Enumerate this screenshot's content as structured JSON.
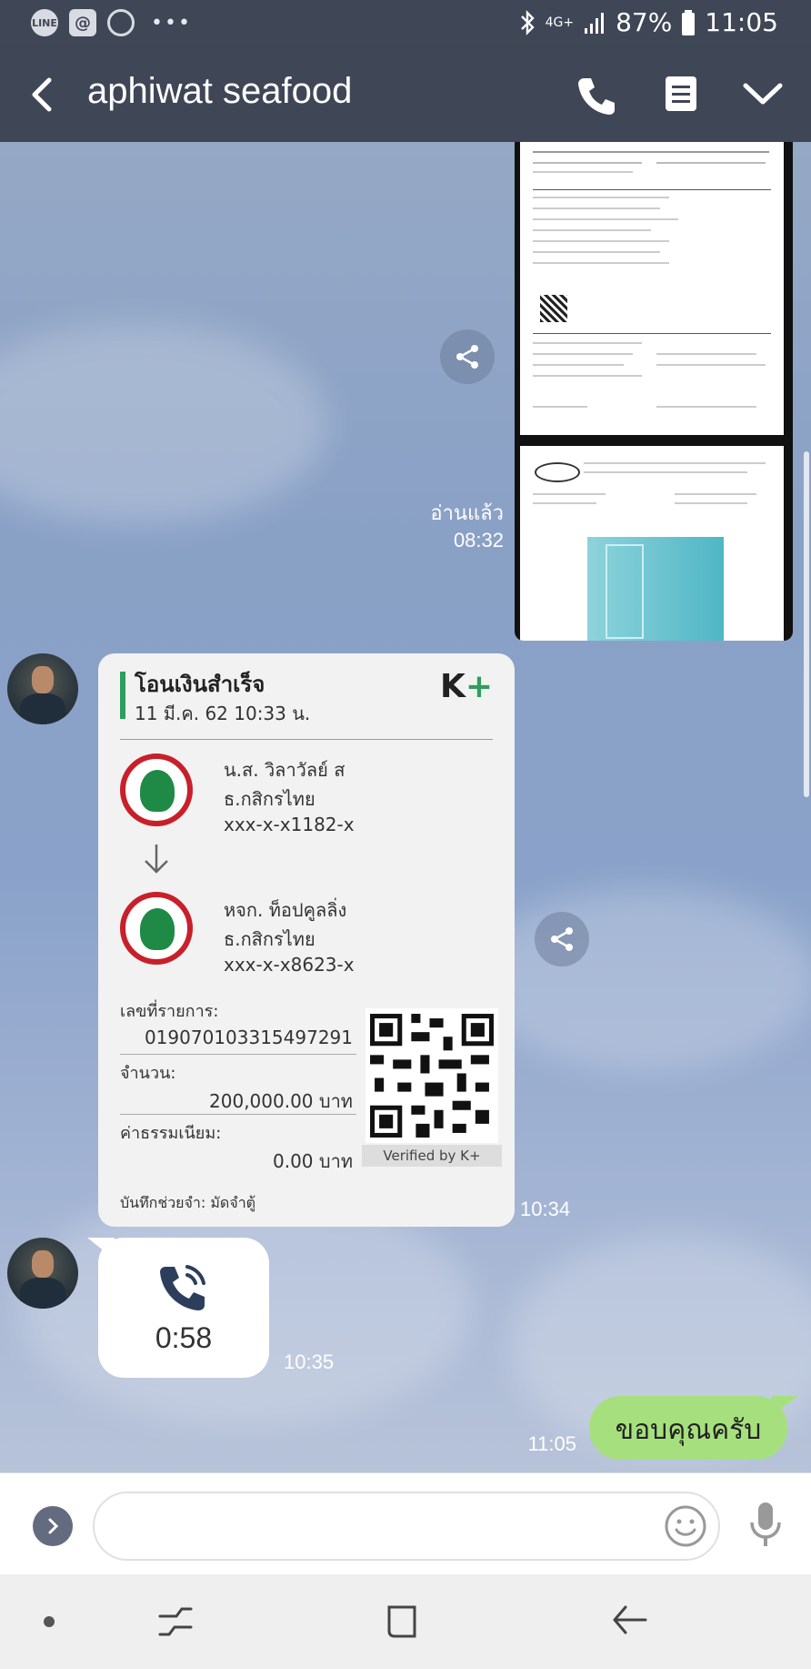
{
  "status_bar": {
    "left_icons": [
      "LINE",
      "@",
      "account-circle"
    ],
    "more": "•••",
    "network": "4G+",
    "battery": "87%",
    "time": "11:05"
  },
  "header": {
    "title": "aphiwat seafood",
    "icons": [
      "back-icon",
      "phone-icon",
      "note-icon",
      "chevron-down-icon"
    ]
  },
  "messages": {
    "image_message": {
      "status": "อ่านแล้ว",
      "time": "08:32"
    },
    "transfer_slip": {
      "title": "โอนเงินสำเร็จ",
      "date": "11 มี.ค. 62  10:33 น.",
      "brand": "K",
      "brand_plus": "+",
      "from_name": "น.ส. วิลาวัลย์ ส",
      "from_bank": "ธ.กสิกรไทย",
      "from_account": "xxx-x-x1182-x",
      "to_name": "หจก. ท็อปคูลลิ่ง",
      "to_bank": "ธ.กสิกรไทย",
      "to_account": "xxx-x-x8623-x",
      "ref_label": "เลขที่รายการ:",
      "ref_value": "019070103315497291",
      "amount_label": "จำนวน:",
      "amount_value": "200,000.00 บาท",
      "fee_label": "ค่าธรรมเนียม:",
      "fee_value": "0.00 บาท",
      "verified": "Verified by K+",
      "memo": "บันทึกช่วยจำ: มัดจำตู้",
      "time": "10:34"
    },
    "call_message": {
      "duration": "0:58",
      "time": "10:35"
    },
    "sent_message": {
      "text": "ขอบคุณครับ",
      "time": "11:05"
    }
  },
  "input": {
    "placeholder": ""
  },
  "colors": {
    "bar": "#3f4656",
    "sent_bubble": "#a6e07e",
    "kbank_green": "#1f8a45",
    "kbank_red": "#c8202a"
  }
}
